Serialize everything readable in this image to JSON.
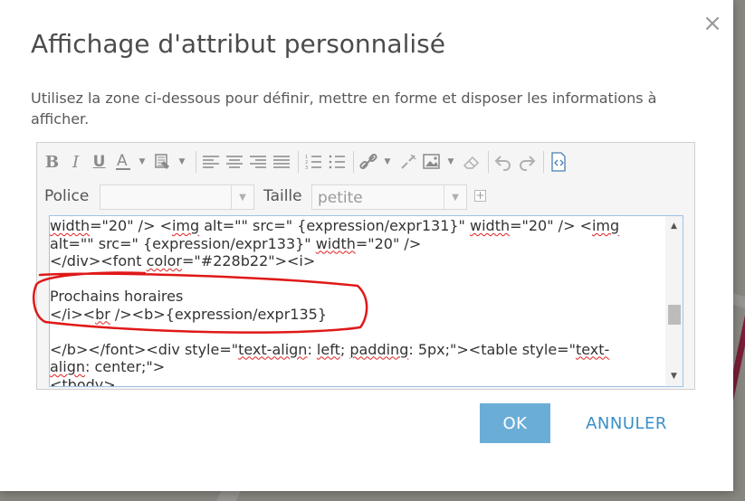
{
  "dialog": {
    "title": "Affichage d'attribut personnalisé",
    "description": "Utilisez la zone ci-dessous pour définir, mettre en forme et disposer les informations à afficher.",
    "close_glyph": "×"
  },
  "toolbar": {
    "bold": "B",
    "italic": "I",
    "underline": "U",
    "font_color": "A"
  },
  "font": {
    "font_label": "Police",
    "font_value": "",
    "size_label": "Taille",
    "size_value": "petite"
  },
  "code": {
    "line1": {
      "a": "width",
      "b": "=\"20\" /> <",
      "c": "img",
      "d": " alt=\"\" src=\" {expression/expr131}\" ",
      "e": "width",
      "f": "=\"20\" />  <",
      "g": "img"
    },
    "line2": {
      "a": "alt=\"\" src=\" {expression/expr133}\" ",
      "b": "width",
      "c": "=\"20\" />"
    },
    "line3": {
      "a": "</div><font ",
      "b": "color",
      "c": "=\"#228b22\"><i>"
    },
    "line5": "Prochains horaires",
    "line6": {
      "a": "</i><",
      "b": "br",
      "c": " /><b>{expression/expr135}"
    },
    "line8": {
      "a": "</b></font><div style=\"",
      "b": "text-align",
      "c": ": ",
      "d": "left",
      "e": "; ",
      "f": "padding",
      "g": ": 5px;\"><table style=\"",
      "h": "text-"
    },
    "line9": {
      "a": "align",
      "b": ": center;\">"
    },
    "line10": "<tbody>"
  },
  "buttons": {
    "ok": "OK",
    "cancel": "ANNULER"
  },
  "colors": {
    "ok_bg": "#6aaed8",
    "cancel_text": "#3a8fc8",
    "annotation": "#e01818"
  }
}
